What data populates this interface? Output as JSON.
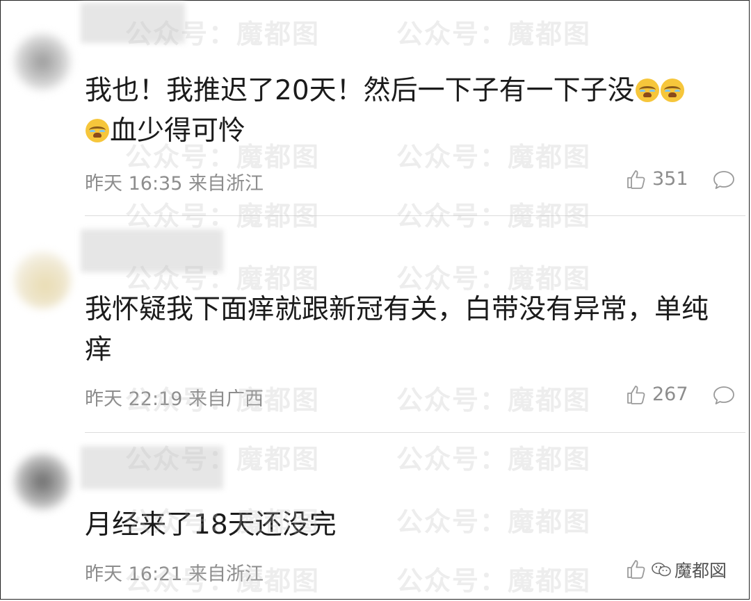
{
  "comments": [
    {
      "text_parts": [
        "我也！我推迟了20天！然后一下子有一下子没",
        "",
        "",
        "",
        "血少得可怜"
      ],
      "time": "昨天 16:35 来自浙江",
      "likes": "351",
      "emoji": "crying-face"
    },
    {
      "text": "我怀疑我下面痒就跟新冠有关，白带没有异常，单纯痒",
      "time": "昨天 22:19 来自广西",
      "likes": "267"
    },
    {
      "text": "月经来了18天还没完",
      "time": "昨天 16:21 来自浙江"
    }
  ],
  "watermark": "公众号：魔都图",
  "brand": "魔都図",
  "colors": {
    "text": "#1b1b1b",
    "meta": "#8d8d8d",
    "emoji": "#f6c63b"
  },
  "icons": [
    "thumbs-up-icon",
    "comment-bubble-icon",
    "wechat-icon"
  ]
}
